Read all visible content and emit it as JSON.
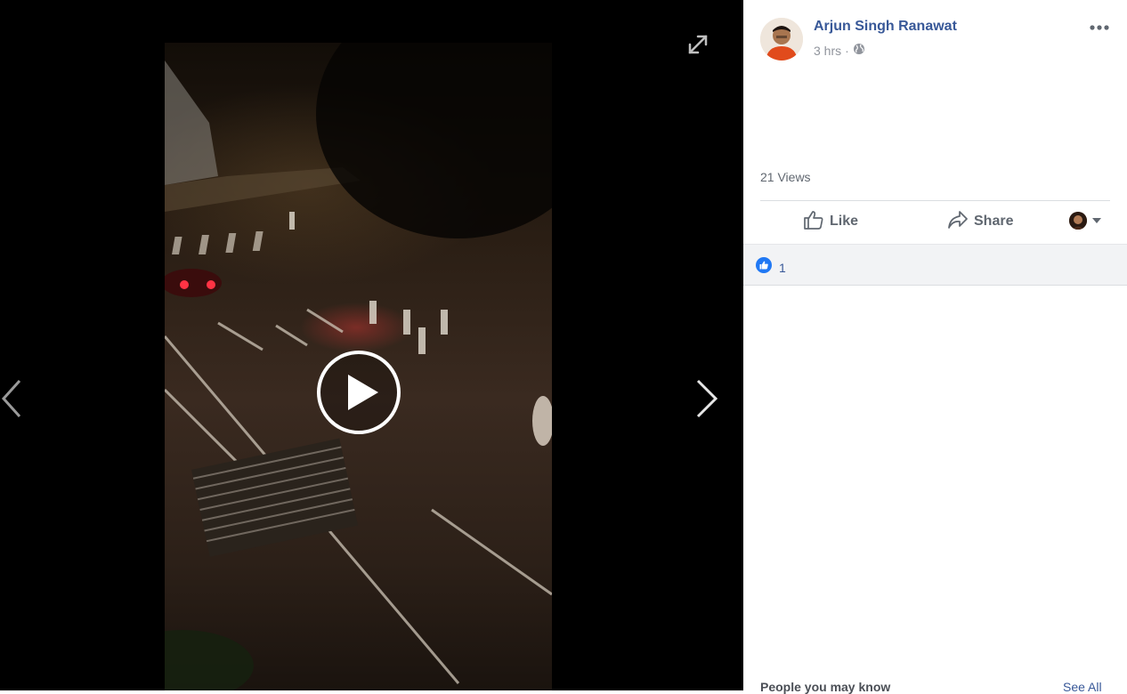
{
  "post": {
    "author": "Arjun Singh Ranawat",
    "time": "3 hrs",
    "separator": "·",
    "views": "21 Views"
  },
  "actions": {
    "like_label": "Like",
    "share_label": "Share"
  },
  "reactions": {
    "count": "1"
  },
  "sidebar": {
    "people_title": "People you may know",
    "see_all": "See All"
  },
  "icons": {
    "expand": "expand-icon",
    "prev": "chevron-left-icon",
    "next": "chevron-right-icon",
    "play": "play-icon",
    "globe": "globe-icon",
    "more": "more-icon",
    "like": "thumbs-up-icon",
    "share": "share-arrow-icon",
    "dropdown": "caret-down-icon"
  },
  "colors": {
    "link": "#385898",
    "like_badge": "#2078f4",
    "muted": "#606770"
  }
}
